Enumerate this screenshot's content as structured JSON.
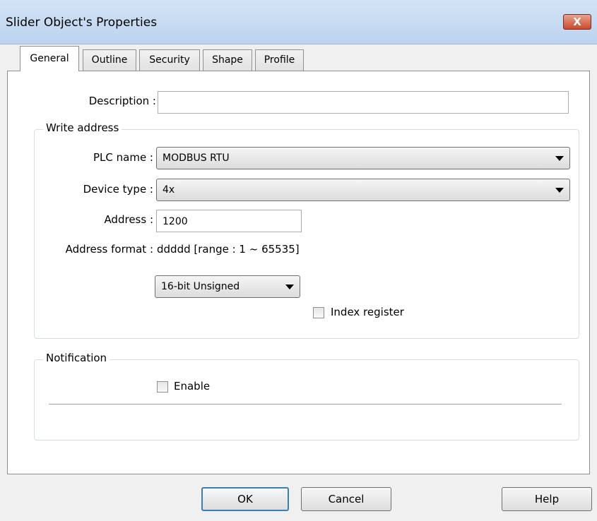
{
  "window": {
    "title": "Slider Object's Properties",
    "close_label": "X"
  },
  "tabs": [
    {
      "label": "General",
      "active": true
    },
    {
      "label": "Outline",
      "active": false
    },
    {
      "label": "Security",
      "active": false
    },
    {
      "label": "Shape",
      "active": false
    },
    {
      "label": "Profile",
      "active": false
    }
  ],
  "general": {
    "description_label": "Description :",
    "description_value": "",
    "write_address": {
      "group_title": "Write address",
      "plc_name_label": "PLC name :",
      "plc_name_value": "MODBUS RTU",
      "device_type_label": "Device type :",
      "device_type_value": "4x",
      "address_label": "Address :",
      "address_value": "1200",
      "address_format_label": "Address format :",
      "address_format_value": "ddddd [range : 1 ~ 65535]",
      "data_format_value": "16-bit Unsigned",
      "index_register_label": "Index register",
      "index_register_checked": false
    },
    "notification": {
      "group_title": "Notification",
      "enable_label": "Enable",
      "enable_checked": false
    }
  },
  "buttons": {
    "ok": "OK",
    "cancel": "Cancel",
    "help": "Help"
  }
}
